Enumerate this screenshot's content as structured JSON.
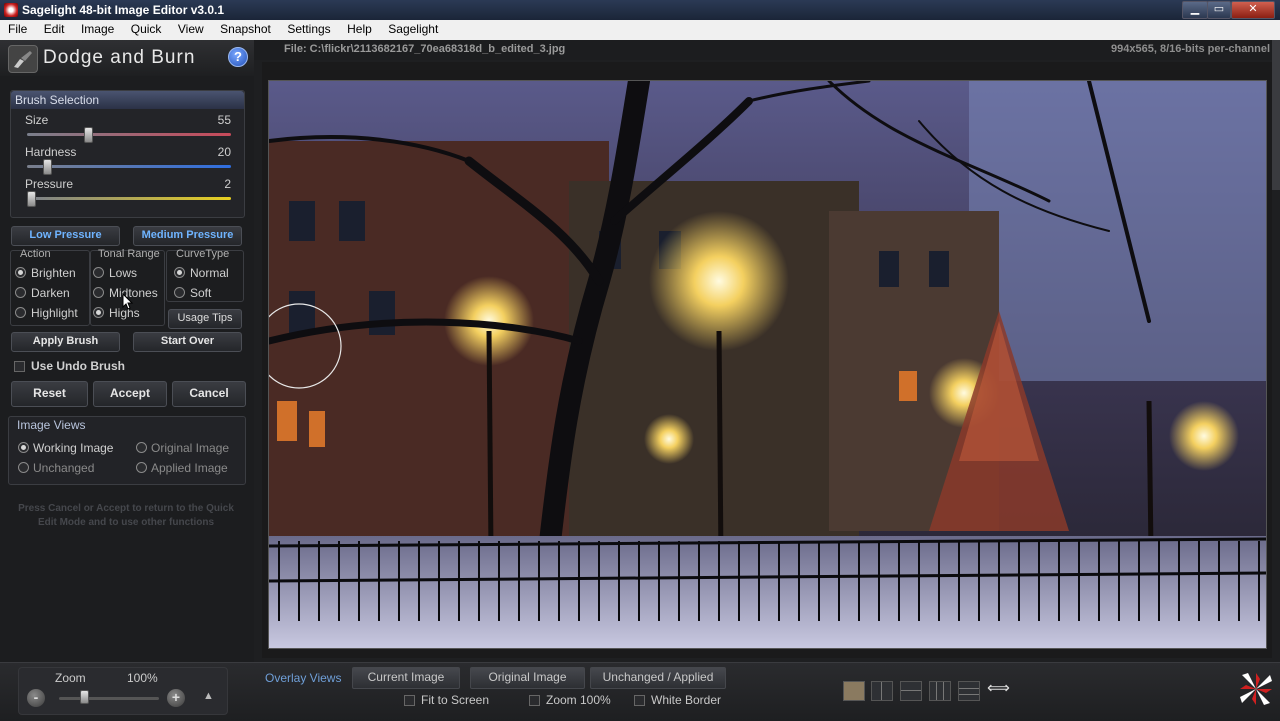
{
  "window": {
    "title": "Sagelight 48-bit Image Editor v3.0.1",
    "min": "▁",
    "max": "▭",
    "close": "✕"
  },
  "menu": [
    "File",
    "Edit",
    "Image",
    "Quick",
    "View",
    "Snapshot",
    "Settings",
    "Help",
    "Sagelight"
  ],
  "panel": {
    "title": "Dodge and Burn",
    "help": "?",
    "brush": {
      "heading": "Brush Selection",
      "sliders": [
        {
          "label": "Size",
          "value": "55",
          "level": 0.3
        },
        {
          "label": "Hardness",
          "value": "20",
          "level": 0.1
        },
        {
          "label": "Pressure",
          "value": "2",
          "level": 0.02
        }
      ]
    },
    "pressure_buttons": [
      "Low Pressure",
      "Medium Pressure"
    ],
    "action": {
      "heading": "Action",
      "options": [
        "Brighten",
        "Darken",
        "Highlight"
      ],
      "selected": 0
    },
    "tonal": {
      "heading": "Tonal Range",
      "options": [
        "Lows",
        "Midtones",
        "Highs"
      ],
      "selected": 2
    },
    "curve": {
      "heading": "CurveType",
      "options": [
        "Normal",
        "Soft"
      ],
      "selected": 0
    },
    "usage_tips": "Usage Tips",
    "apply_brush": "Apply Brush",
    "start_over": "Start Over",
    "use_undo": "Use Undo Brush",
    "reset": "Reset",
    "accept": "Accept",
    "cancel": "Cancel",
    "views": {
      "heading": "Image Views",
      "options": [
        "Working Image",
        "Original Image",
        "Unchanged",
        "Applied Image"
      ],
      "selected": 0
    },
    "hint": "Press Cancel or Accept to return to the Quick Edit Mode and to use other functions"
  },
  "file": {
    "name": "File: C:\\flickr\\2113682167_70ea68318d_b_edited_3.jpg",
    "info": "994x565, 8/16-bits per-channel"
  },
  "bottom": {
    "zoom_label": "Zoom",
    "zoom_value": "100%",
    "zoom_level": 0.25,
    "minus": "-",
    "plus": "+",
    "up": "▲",
    "overlay_label": "Overlay Views",
    "tabs": [
      "Current Image",
      "Original Image",
      "Unchanged / Applied"
    ],
    "checks": [
      "Fit to Screen",
      "Zoom 100%",
      "White Border"
    ],
    "arrows": "⟺"
  },
  "colors": {
    "accent": "#6fb4ff",
    "overlay_label": "#6f9fd8"
  }
}
